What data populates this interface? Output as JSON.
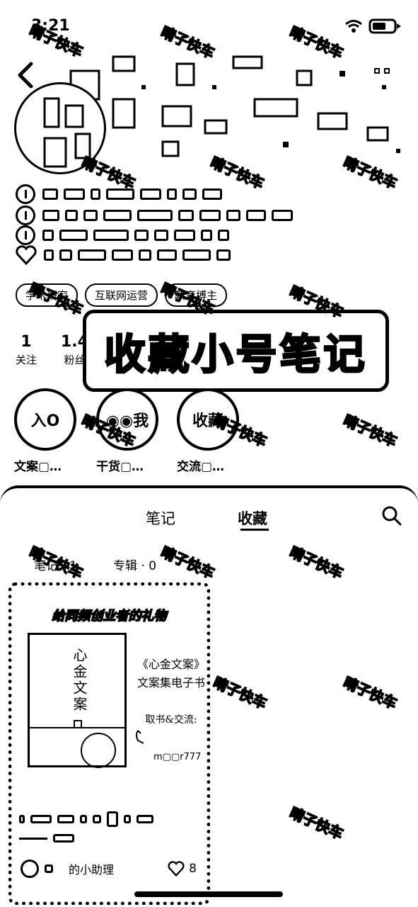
{
  "status": {
    "time": "3:21"
  },
  "bio": {
    "tags": [
      "学术研究",
      "互联网运营",
      "教育博主"
    ]
  },
  "stats": [
    {
      "num": "1",
      "label": "关注"
    },
    {
      "num": "1.4",
      "label": "粉丝"
    }
  ],
  "banner": {
    "text": "收藏小号笔记"
  },
  "shortcuts": [
    {
      "icon_text": "入O",
      "label": "文案▢…"
    },
    {
      "icon_text": "◉◉我",
      "label": "干货▢…"
    },
    {
      "icon_text": "收藏",
      "label": "交流▢…"
    }
  ],
  "tabs": {
    "notes": "笔记",
    "collect": "收藏"
  },
  "subtabs": {
    "notes": "笔记 · 1",
    "albums": "专辑 · 0"
  },
  "card": {
    "banner": "给同频创业者的礼物",
    "book_title": "心金文案",
    "info_line1": "《心金文案》",
    "info_line2": "文案集电子书",
    "info_line3": "取书&交流:",
    "wechat_id": "m▢▢r777",
    "author": "的小助理",
    "likes": "8"
  },
  "watermark": "晴子快车",
  "colors": {
    "ink": "#000000",
    "paper": "#ffffff"
  }
}
